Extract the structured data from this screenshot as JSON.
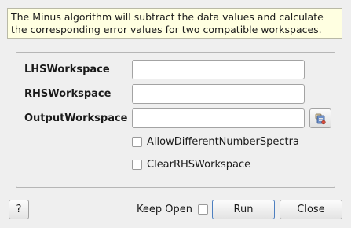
{
  "description": {
    "line1": "The Minus algorithm will subtract the data values and calculate",
    "line2": "the corresponding error values for two compatible workspaces."
  },
  "properties": {
    "lhs_label": "LHSWorkspace",
    "lhs_value": "",
    "rhs_label": "RHSWorkspace",
    "rhs_value": "",
    "output_label": "OutputWorkspace",
    "output_value": "",
    "allow_diff_label": "AllowDifferentNumberSpectra",
    "allow_diff_checked": false,
    "clear_rhs_label": "ClearRHSWorkspace",
    "clear_rhs_checked": false
  },
  "footer": {
    "help_label": "?",
    "keep_open_label": "Keep Open",
    "keep_open_checked": false,
    "run_label": "Run",
    "close_label": "Close"
  },
  "icons": {
    "browse": "workspace-browse-icon"
  }
}
